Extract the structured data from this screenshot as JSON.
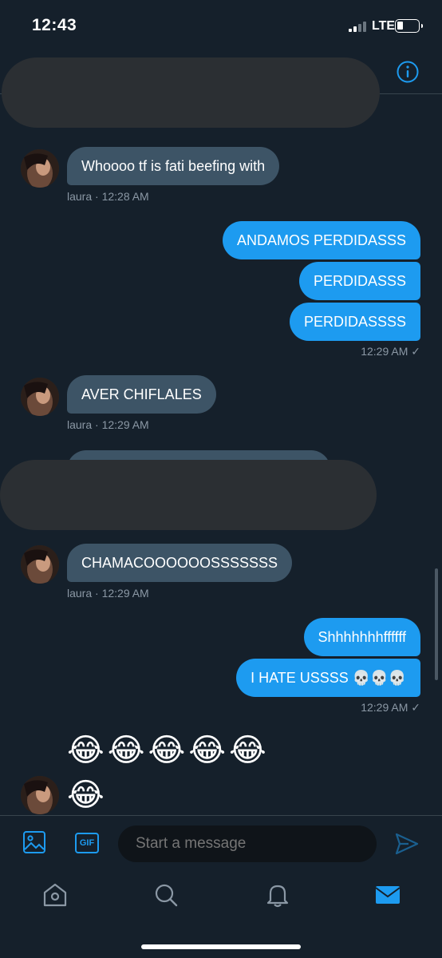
{
  "status_bar": {
    "time": "12:43",
    "network": "LTE"
  },
  "composer": {
    "placeholder": "Start a message",
    "gif_label": "GIF"
  },
  "messages": [
    {
      "sender": "laura",
      "text": "Whoooo tf is fati beefing with",
      "meta": "laura · 12:28 AM"
    },
    {
      "sender": "me",
      "text": "ANDAMOS PERDIDASSS"
    },
    {
      "sender": "me",
      "text": "PERDIDASSS"
    },
    {
      "sender": "me",
      "text": "PERDIDASSSS",
      "meta": "12:29 AM ✓"
    },
    {
      "sender": "laura",
      "text": "AVER CHIFLALES",
      "meta": "laura · 12:29 AM"
    },
    {
      "sender": "laura",
      "text": "CHAMACOOOOOOSSSSSSS",
      "meta": "laura · 12:29 AM"
    },
    {
      "sender": "me",
      "text": "Shhhhhhhffffff"
    },
    {
      "sender": "me",
      "text": "I HATE USSSS 💀💀💀",
      "meta": "12:29 AM ✓"
    },
    {
      "sender": "laura",
      "text": "😂😂😂😂😂"
    },
    {
      "sender": "laura",
      "text": "😂"
    }
  ],
  "colors": {
    "background": "#15202b",
    "outgoing_bubble": "#1d9bf0",
    "incoming_bubble": "#3d5466",
    "accent": "#1d9bf0"
  },
  "icons": [
    "info-icon",
    "image-icon",
    "gif-icon",
    "send-icon",
    "home-icon",
    "search-icon",
    "bell-icon",
    "mail-icon"
  ]
}
